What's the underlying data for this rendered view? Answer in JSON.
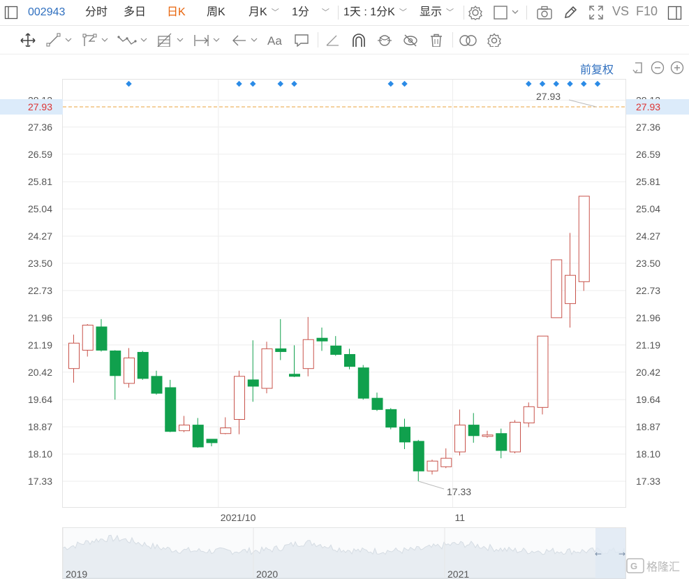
{
  "topbar": {
    "code": "002943",
    "tabs": [
      "分时",
      "多日",
      "日K",
      "周K",
      "月K",
      "1分"
    ],
    "period": "1天 : 1分K",
    "display": "显示",
    "vs": "VS",
    "f10": "F10"
  },
  "fuquan": "前复权",
  "chart_data": {
    "type": "candlestick",
    "title": "",
    "y_ticks": [
      "28.12",
      "27.36",
      "26.59",
      "25.81",
      "25.04",
      "24.27",
      "23.50",
      "22.73",
      "21.96",
      "21.19",
      "20.42",
      "19.64",
      "18.87",
      "18.10",
      "17.33"
    ],
    "ylim": [
      17.0,
      28.4
    ],
    "x_labels": [
      {
        "label": "2021/10",
        "index": 11
      },
      {
        "label": "11",
        "index": 28
      }
    ],
    "high_marker": "27.93",
    "low_marker": "17.33",
    "price_line": "27.93",
    "up_color": "#c8534b",
    "down_color": "#10a04d",
    "candles": [
      {
        "o": 20.52,
        "c": 21.24,
        "h": 21.48,
        "l": 20.12
      },
      {
        "o": 21.04,
        "c": 21.75,
        "h": 21.78,
        "l": 20.86
      },
      {
        "o": 21.7,
        "c": 21.04,
        "h": 21.92,
        "l": 21.0
      },
      {
        "o": 21.02,
        "c": 20.32,
        "h": 21.04,
        "l": 19.64
      },
      {
        "o": 20.1,
        "c": 20.82,
        "h": 21.1,
        "l": 19.98
      },
      {
        "o": 20.98,
        "c": 20.24,
        "h": 21.02,
        "l": 20.2
      },
      {
        "o": 20.3,
        "c": 19.82,
        "h": 20.46,
        "l": 19.78
      },
      {
        "o": 19.98,
        "c": 18.74,
        "h": 20.2,
        "l": 18.72
      },
      {
        "o": 18.76,
        "c": 18.92,
        "h": 19.18,
        "l": 18.72
      },
      {
        "o": 18.92,
        "c": 18.3,
        "h": 19.12,
        "l": 18.28
      },
      {
        "o": 18.52,
        "c": 18.42,
        "h": 18.52,
        "l": 18.32
      },
      {
        "o": 18.68,
        "c": 18.84,
        "h": 19.14,
        "l": 18.66
      },
      {
        "o": 19.08,
        "c": 20.3,
        "h": 20.46,
        "l": 18.66
      },
      {
        "o": 20.2,
        "c": 20.02,
        "h": 21.32,
        "l": 19.58
      },
      {
        "o": 19.96,
        "c": 21.08,
        "h": 21.28,
        "l": 19.82
      },
      {
        "o": 21.08,
        "c": 21.0,
        "h": 21.92,
        "l": 20.76
      },
      {
        "o": 20.36,
        "c": 20.3,
        "h": 21.18,
        "l": 20.28
      },
      {
        "o": 20.52,
        "c": 21.34,
        "h": 21.98,
        "l": 20.3
      },
      {
        "o": 21.38,
        "c": 21.3,
        "h": 21.68,
        "l": 21.02
      },
      {
        "o": 21.16,
        "c": 20.92,
        "h": 21.44,
        "l": 20.88
      },
      {
        "o": 20.92,
        "c": 20.58,
        "h": 21.08,
        "l": 20.5
      },
      {
        "o": 20.54,
        "c": 19.68,
        "h": 20.62,
        "l": 19.64
      },
      {
        "o": 19.68,
        "c": 19.36,
        "h": 19.84,
        "l": 19.32
      },
      {
        "o": 19.36,
        "c": 18.86,
        "h": 19.4,
        "l": 18.8
      },
      {
        "o": 18.86,
        "c": 18.44,
        "h": 19.1,
        "l": 18.24
      },
      {
        "o": 18.46,
        "c": 17.62,
        "h": 18.5,
        "l": 17.33
      },
      {
        "o": 17.62,
        "c": 17.9,
        "h": 17.94,
        "l": 17.52
      },
      {
        "o": 17.74,
        "c": 17.98,
        "h": 18.26,
        "l": 17.7
      },
      {
        "o": 18.16,
        "c": 18.92,
        "h": 19.36,
        "l": 18.06
      },
      {
        "o": 18.92,
        "c": 18.62,
        "h": 19.26,
        "l": 18.42
      },
      {
        "o": 18.6,
        "c": 18.64,
        "h": 18.76,
        "l": 18.56
      },
      {
        "o": 18.68,
        "c": 18.2,
        "h": 18.82,
        "l": 17.98
      },
      {
        "o": 18.16,
        "c": 19.0,
        "h": 19.06,
        "l": 18.12
      },
      {
        "o": 18.98,
        "c": 19.44,
        "h": 19.56,
        "l": 18.86
      },
      {
        "o": 19.42,
        "c": 21.44,
        "h": 21.44,
        "l": 19.22
      },
      {
        "o": 21.96,
        "c": 23.6,
        "h": 23.6,
        "l": 21.96
      },
      {
        "o": 22.36,
        "c": 23.16,
        "h": 24.36,
        "l": 21.68
      },
      {
        "o": 22.98,
        "c": 25.4,
        "h": 25.4,
        "l": 22.72
      }
    ],
    "event_dot_indices": [
      4,
      12,
      13,
      15,
      16,
      23,
      24,
      33,
      34,
      35,
      36,
      37,
      38
    ],
    "navigator_labels": [
      "2019",
      "2020",
      "2021"
    ]
  },
  "brand": "格隆汇"
}
